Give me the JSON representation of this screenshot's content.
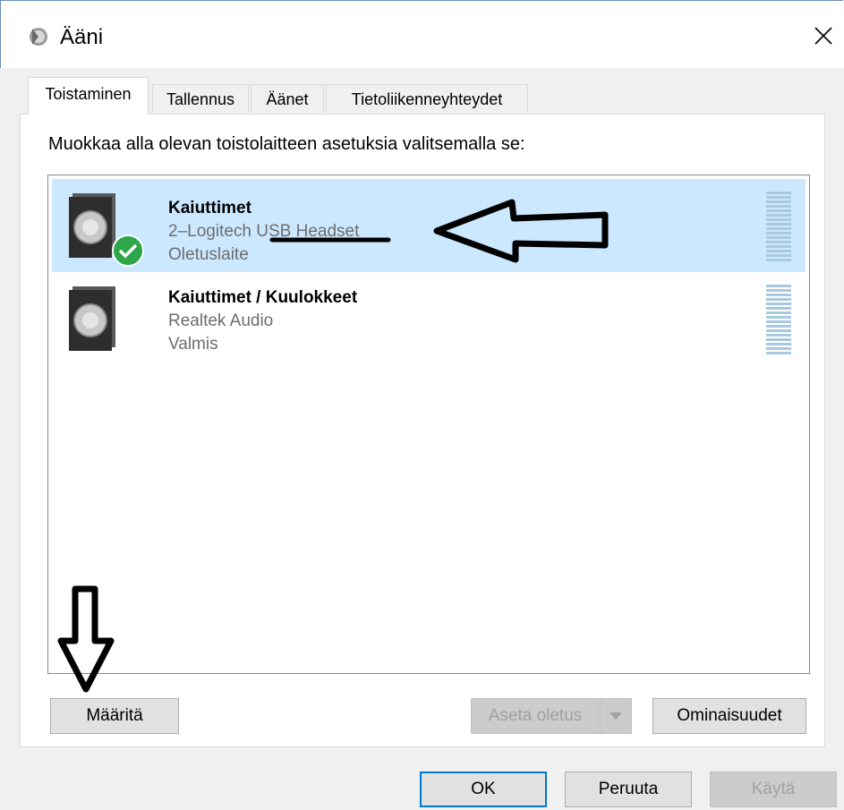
{
  "window": {
    "title": "Ääni",
    "close_label": "×"
  },
  "tabs": [
    {
      "label": "Toistaminen",
      "active": true
    },
    {
      "label": "Tallennus",
      "active": false
    },
    {
      "label": "Äänet",
      "active": false
    },
    {
      "label": "Tietoliikenneyhteydet",
      "active": false
    }
  ],
  "instruction": "Muokkaa alla olevan toistolaitteen asetuksia valitsemalla se:",
  "devices": [
    {
      "name": "Kaiuttimet",
      "description": "2–Logitech USB Headset",
      "status": "Oletuslaite",
      "is_default": true,
      "selected": true
    },
    {
      "name": "Kaiuttimet / Kuulokkeet",
      "description": "Realtek Audio",
      "status": "Valmis",
      "is_default": false,
      "selected": false
    }
  ],
  "buttons": {
    "configure": "Määritä",
    "set_default": "Aseta oletus",
    "properties": "Ominaisuudet",
    "ok": "OK",
    "cancel": "Peruuta",
    "apply": "Käytä"
  },
  "colors": {
    "selection": "#cce8ff",
    "default_badge": "#2ea64a",
    "accent": "#0078d7"
  }
}
